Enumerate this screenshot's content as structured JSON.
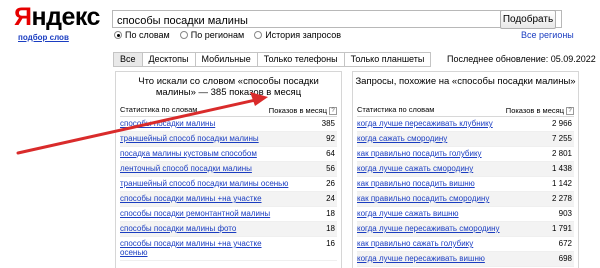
{
  "header": {
    "logo_y": "Я",
    "logo_rest": "ндекс",
    "logo_sub": "подбор слов",
    "search_value": "способы посадки малины",
    "search_button": "Подобрать",
    "radios": [
      {
        "label": "По словам",
        "checked": true
      },
      {
        "label": "По регионам",
        "checked": false
      },
      {
        "label": "История запросов",
        "checked": false
      }
    ],
    "regions_link": "Все регионы"
  },
  "tabs": [
    {
      "label": "Все",
      "active": true
    },
    {
      "label": "Десктопы",
      "active": false
    },
    {
      "label": "Мобильные",
      "active": false
    },
    {
      "label": "Только телефоны",
      "active": false
    },
    {
      "label": "Только планшеты",
      "active": false
    }
  ],
  "last_update": "Последнее обновление: 05.09.2022",
  "left_panel": {
    "title": "Что искали со словом «способы посадки малины» — 385 показов в месяц",
    "col_keyword": "Статистика по словам",
    "col_count": "Показов в месяц",
    "rows": [
      {
        "kw": "способы посадки малины",
        "count": "385"
      },
      {
        "kw": "траншейный способ посадки малины",
        "count": "92"
      },
      {
        "kw": "посадка малины кустовым способом",
        "count": "64"
      },
      {
        "kw": "ленточный способ посадки малины",
        "count": "56"
      },
      {
        "kw": "траншейный способ посадки малины осенью",
        "count": "26"
      },
      {
        "kw": "способы посадки малины +на участке",
        "count": "24"
      },
      {
        "kw": "способы посадки ремонтантной малины",
        "count": "18"
      },
      {
        "kw": "способы посадки малины фото",
        "count": "18"
      },
      {
        "kw": "способы посадки малины +на участке осенью",
        "count": "16"
      }
    ]
  },
  "right_panel": {
    "title": "Запросы, похожие на «способы посадки малины»",
    "col_keyword": "Статистика по словам",
    "col_count": "Показов в месяц",
    "rows": [
      {
        "kw": "когда лучше пересаживать клубнику",
        "count": "2 966"
      },
      {
        "kw": "когда сажать смородину",
        "count": "7 255"
      },
      {
        "kw": "как правильно посадить голубику",
        "count": "2 801"
      },
      {
        "kw": "когда лучше сажать смородину",
        "count": "1 438"
      },
      {
        "kw": "как правильно посадить вишню",
        "count": "1 142"
      },
      {
        "kw": "как правильно посадить смородину",
        "count": "2 278"
      },
      {
        "kw": "когда лучше сажать вишню",
        "count": "903"
      },
      {
        "kw": "когда лучше пересаживать смородину",
        "count": "1 791"
      },
      {
        "kw": "как правильно сажать голубику",
        "count": "672"
      },
      {
        "kw": "когда лучше пересаживать вишню",
        "count": "698"
      }
    ]
  },
  "colors": {
    "link": "#1a3dc1",
    "logo_red": "#e60000",
    "arrow": "#d92b2b"
  }
}
